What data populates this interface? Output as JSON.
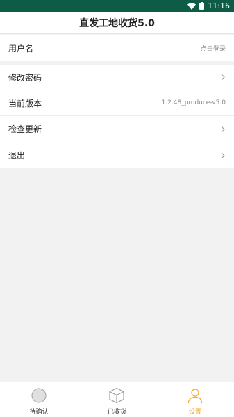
{
  "status_bar": {
    "time": "11:16",
    "icons": [
      "wifi-icon",
      "battery-icon"
    ]
  },
  "header": {
    "title": "直发工地收货5.0"
  },
  "settings": {
    "user_row": {
      "label": "用户名",
      "value": "点击登录"
    },
    "change_password": {
      "label": "修改密码",
      "icon": "chevron-right-icon"
    },
    "current_version": {
      "label": "当前版本",
      "value": "1.2.48_produce-v5.0"
    },
    "check_update": {
      "label": "检查更新",
      "icon": "chevron-right-icon"
    },
    "logout": {
      "label": "退出",
      "icon": "chevron-right-icon"
    }
  },
  "bottom_nav": {
    "items": [
      {
        "label": "待确认",
        "icon": "circle-icon",
        "active": false
      },
      {
        "label": "已收货",
        "icon": "box-icon",
        "active": false
      },
      {
        "label": "设置",
        "icon": "person-icon",
        "active": true
      }
    ]
  },
  "colors": {
    "status_bar": "#0f5c46",
    "active_tab": "#f5a623",
    "background": "#f2f2f2"
  }
}
